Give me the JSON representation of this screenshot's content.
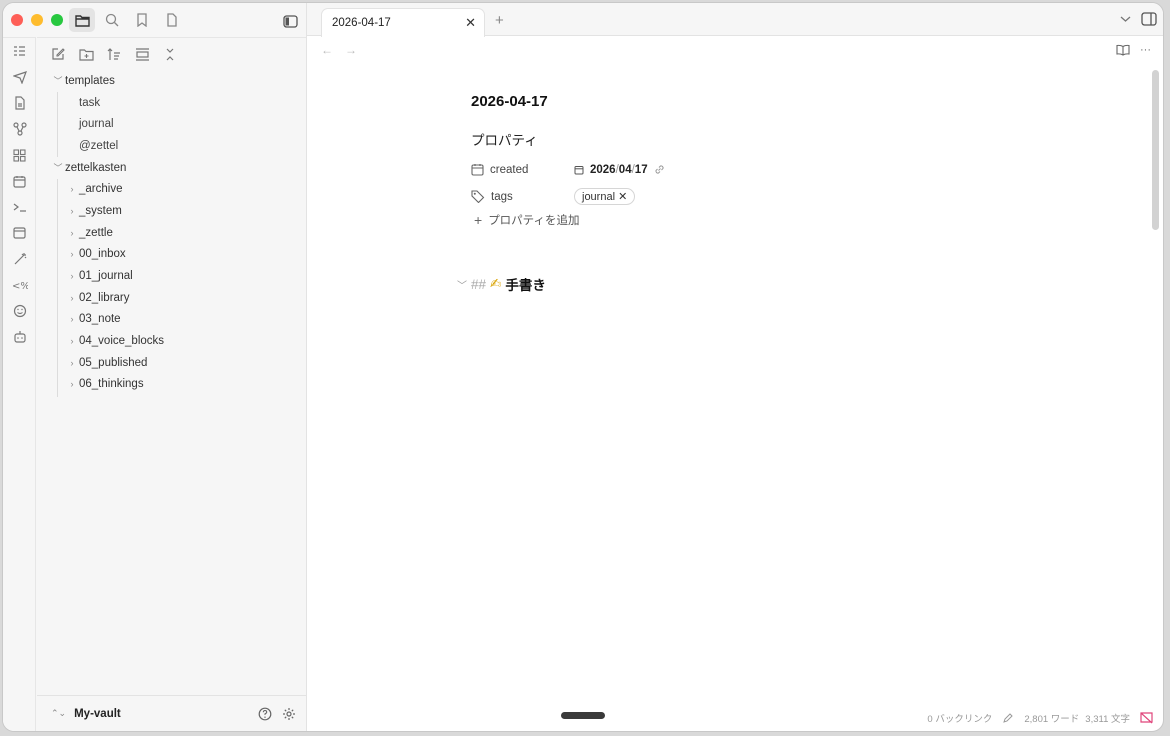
{
  "tab": {
    "title": "2026-04-17"
  },
  "tree": {
    "templates": {
      "label": "templates",
      "children": [
        "task",
        "journal",
        "@zettel"
      ]
    },
    "zettelkasten": {
      "label": "zettelkasten",
      "children": [
        "_archive",
        "_system",
        "_zettle",
        "00_inbox",
        "01_journal",
        "02_library",
        "03_note",
        "04_voice_blocks",
        "05_published",
        "06_thinkings"
      ]
    }
  },
  "vault": {
    "name": "My-vault"
  },
  "note": {
    "title": "2026-04-17",
    "properties_heading": "プロパティ",
    "properties": {
      "created_key": "created",
      "created_year": "2026",
      "created_sep1": "/",
      "created_month": "04",
      "created_sep2": "/",
      "created_day": "17",
      "tags_key": "tags",
      "tag_value": "journal"
    },
    "add_property": "プロパティを追加",
    "heading_hash": "##",
    "heading_emoji": "✍",
    "heading_text": "手書き"
  },
  "status": {
    "backlinks": "0 バックリンク",
    "words": "2,801 ワード",
    "chars": "3,311 文字"
  },
  "colors": {
    "accent": "#e0457b",
    "sidebar_bg": "#f6f6f6"
  }
}
